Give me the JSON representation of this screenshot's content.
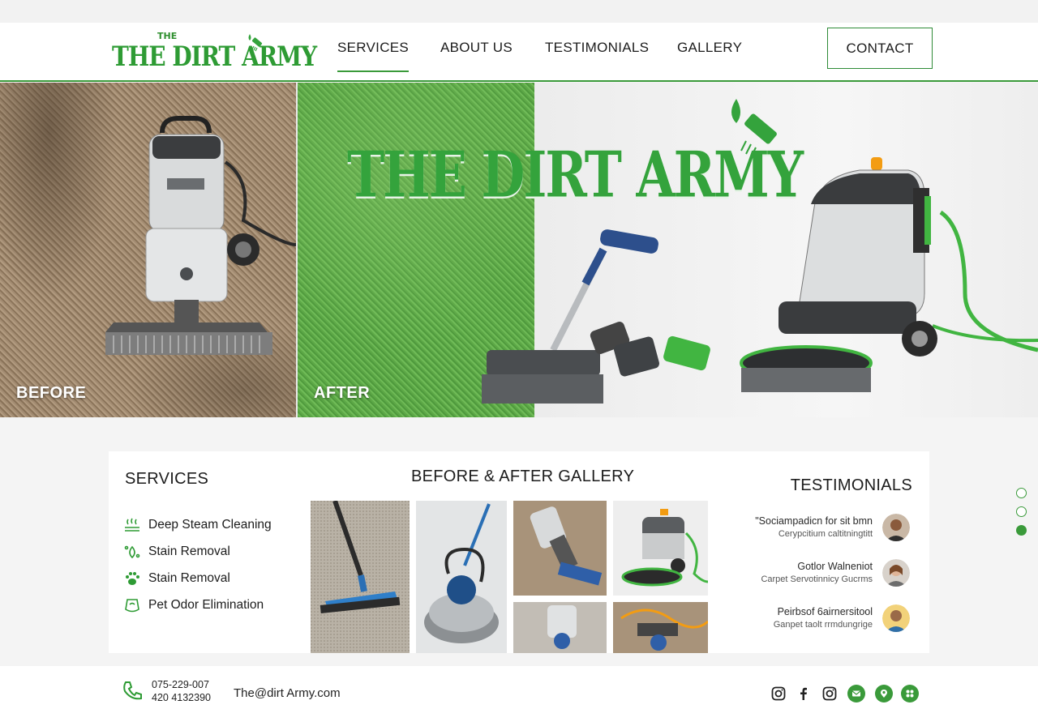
{
  "header": {
    "logo_small": "THE",
    "logo_big": "THE DIRT ARMY",
    "nav": [
      "SERVICES",
      "ABOUT US",
      "TESTIMONIALS",
      "GALLERY"
    ],
    "active_nav": "SERVICES",
    "contact_label": "CONTACT"
  },
  "hero": {
    "before_label": "BEFORE",
    "after_label": "AFTER",
    "title": "THE DIRT ARMY"
  },
  "services": {
    "title": "SERVICES",
    "items": [
      {
        "label": "Deep Steam Cleaning",
        "icon": "steam-icon"
      },
      {
        "label": "Stain Removal",
        "icon": "stain-icon"
      },
      {
        "label": "Stain Removal",
        "icon": "paw-icon"
      },
      {
        "label": "Pet Odor Elimination",
        "icon": "odor-icon"
      }
    ]
  },
  "gallery": {
    "title": "BEFORE & AFTER GALLERY"
  },
  "testimonials": {
    "title": "TESTIMONIALS",
    "items": [
      {
        "quote": "\"Sociampadicn for sit bmn",
        "sub": "Cerypcitium caltitningtitt"
      },
      {
        "quote": "Gotlor Walneniot",
        "sub": "Carpet Servotinnicy Gucrms"
      },
      {
        "quote": "Peirbsof 6airnersitool",
        "sub": "Ganpet taolt rrmdungrige"
      }
    ]
  },
  "footer": {
    "phone1": "075-229-007",
    "phone2": "420 4132390",
    "email": "The@dirt Army.com"
  },
  "colors": {
    "brand_green": "#34a33c",
    "accent_green": "#3a9a3a"
  }
}
